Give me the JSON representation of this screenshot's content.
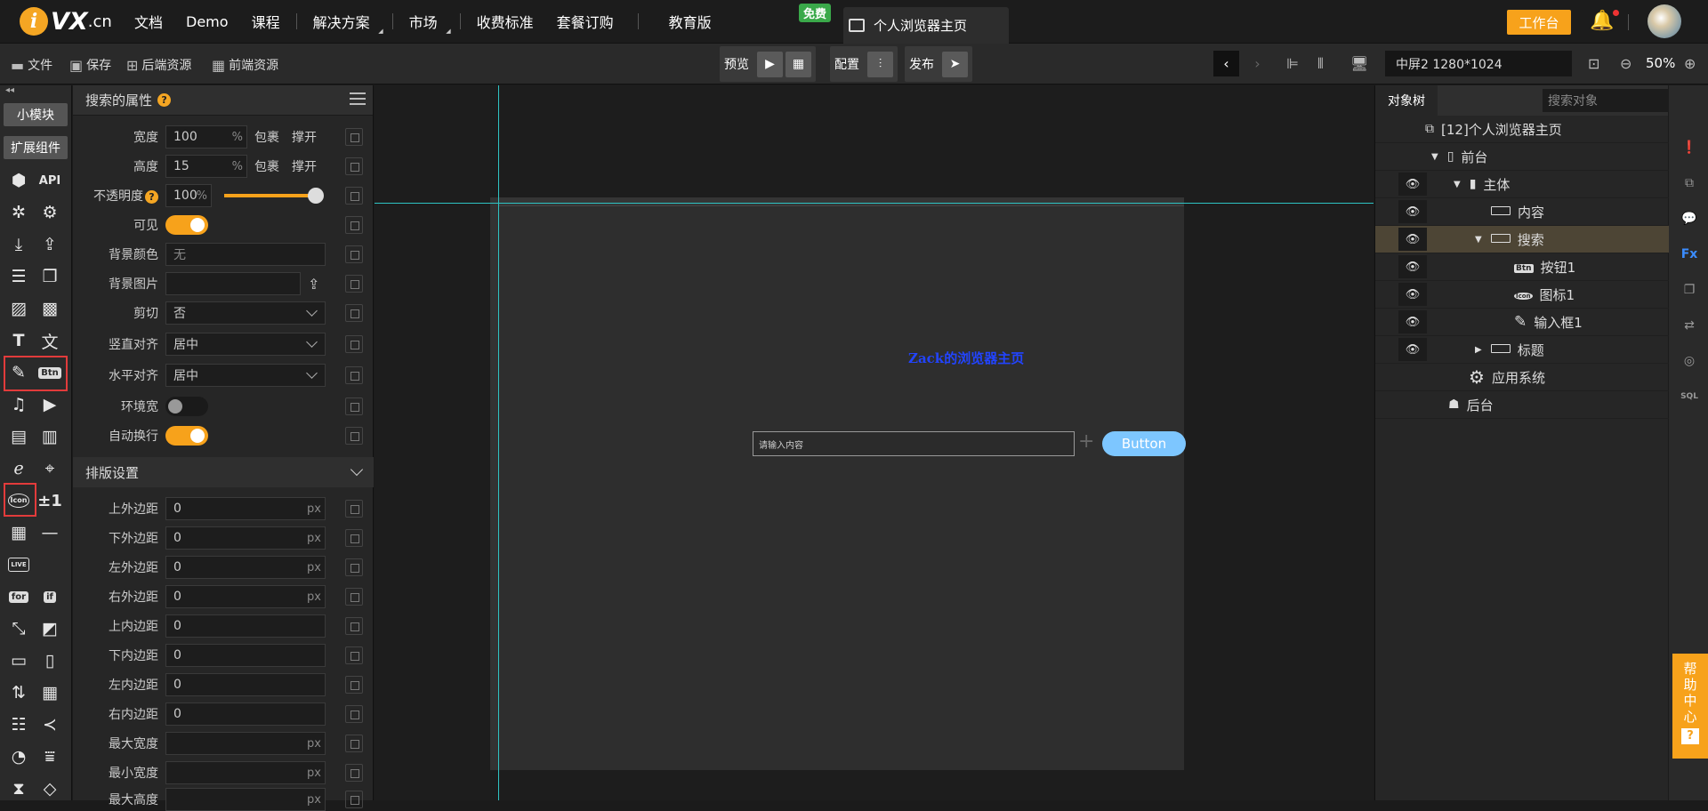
{
  "nav": {
    "logo_i": "i",
    "logo_vx": "VX",
    "logo_cn": ".cn",
    "links": [
      "文档",
      "Demo",
      "课程",
      "解决方案",
      "市场",
      "收费标准",
      "套餐订购",
      "教育版"
    ],
    "free_badge": "免费",
    "page_tab": "个人浏览器主页",
    "workbench": "工作台"
  },
  "toolbar": {
    "file": "文件",
    "save": "保存",
    "backend": "后端资源",
    "frontend": "前端资源",
    "preview": "预览",
    "config": "配置",
    "publish": "发布",
    "screen": "中屏2 1280*1024",
    "zoom": "50%"
  },
  "iconbar": {
    "small_module": "小模块",
    "ext_components": "扩展组件",
    "api": "API",
    "btn": "Btn",
    "icon": "Icon",
    "plusminus": "±1",
    "live": "LIVE",
    "for": "for",
    "if": "if"
  },
  "props": {
    "title": "搜索的属性",
    "width_label": "宽度",
    "width_value": "100",
    "width_unit": "%",
    "wrap": "包裹",
    "expand": "撑开",
    "height_label": "高度",
    "height_value": "15",
    "height_unit": "%",
    "opacity_label": "不透明度",
    "opacity_value": "100",
    "opacity_unit": "%",
    "opacity_level": 1.0,
    "visible_label": "可见",
    "visible": true,
    "bgcolor_label": "背景颜色",
    "bgcolor_placeholder": "无",
    "bgimage_label": "背景图片",
    "clip_label": "剪切",
    "clip_value": "否",
    "valign_label": "竖直对齐",
    "valign_value": "居中",
    "halign_label": "水平对齐",
    "halign_value": "居中",
    "envwidth_label": "环境宽",
    "envwidth": false,
    "autowrap_label": "自动换行",
    "autowrap": true
  },
  "layout": {
    "title": "排版设置",
    "rows": [
      {
        "label": "上外边距",
        "value": "0",
        "unit": "px"
      },
      {
        "label": "下外边距",
        "value": "0",
        "unit": "px"
      },
      {
        "label": "左外边距",
        "value": "0",
        "unit": "px"
      },
      {
        "label": "右外边距",
        "value": "0",
        "unit": "px"
      },
      {
        "label": "上内边距",
        "value": "0",
        "unit": ""
      },
      {
        "label": "下内边距",
        "value": "0",
        "unit": ""
      },
      {
        "label": "左内边距",
        "value": "0",
        "unit": ""
      },
      {
        "label": "右内边距",
        "value": "0",
        "unit": ""
      },
      {
        "label": "最大宽度",
        "value": "",
        "unit": "px"
      },
      {
        "label": "最小宽度",
        "value": "",
        "unit": "px"
      },
      {
        "label": "最大高度",
        "value": "",
        "unit": "px"
      }
    ]
  },
  "stage": {
    "title": "Zack的浏览器主页",
    "input_placeholder": "请输入内容",
    "button": "Button"
  },
  "tree": {
    "tab": "对象树",
    "search_placeholder": "搜索对象",
    "nodes": {
      "root": "[12]个人浏览器主页",
      "front": "前台",
      "body": "主体",
      "content": "内容",
      "search": "搜索",
      "button1": "按钮1",
      "icon1": "图标1",
      "input1": "输入框1",
      "title": "标题",
      "appsys": "应用系统",
      "back": "后台"
    },
    "btn_pill": "Btn",
    "icon_pill": "Icon"
  },
  "rstrip": {
    "fx": "Fx",
    "sql": "SQL"
  },
  "help": {
    "chars": [
      "帮",
      "助",
      "中",
      "心"
    ],
    "q": "?"
  },
  "colors": {
    "accent": "#f7a21b",
    "guide": "#2ec4c4",
    "free_badge": "#3aa94a",
    "stage_button": "#7dc6ff",
    "stage_title": "#2244ff",
    "highlight_box": "#e23b3b"
  }
}
